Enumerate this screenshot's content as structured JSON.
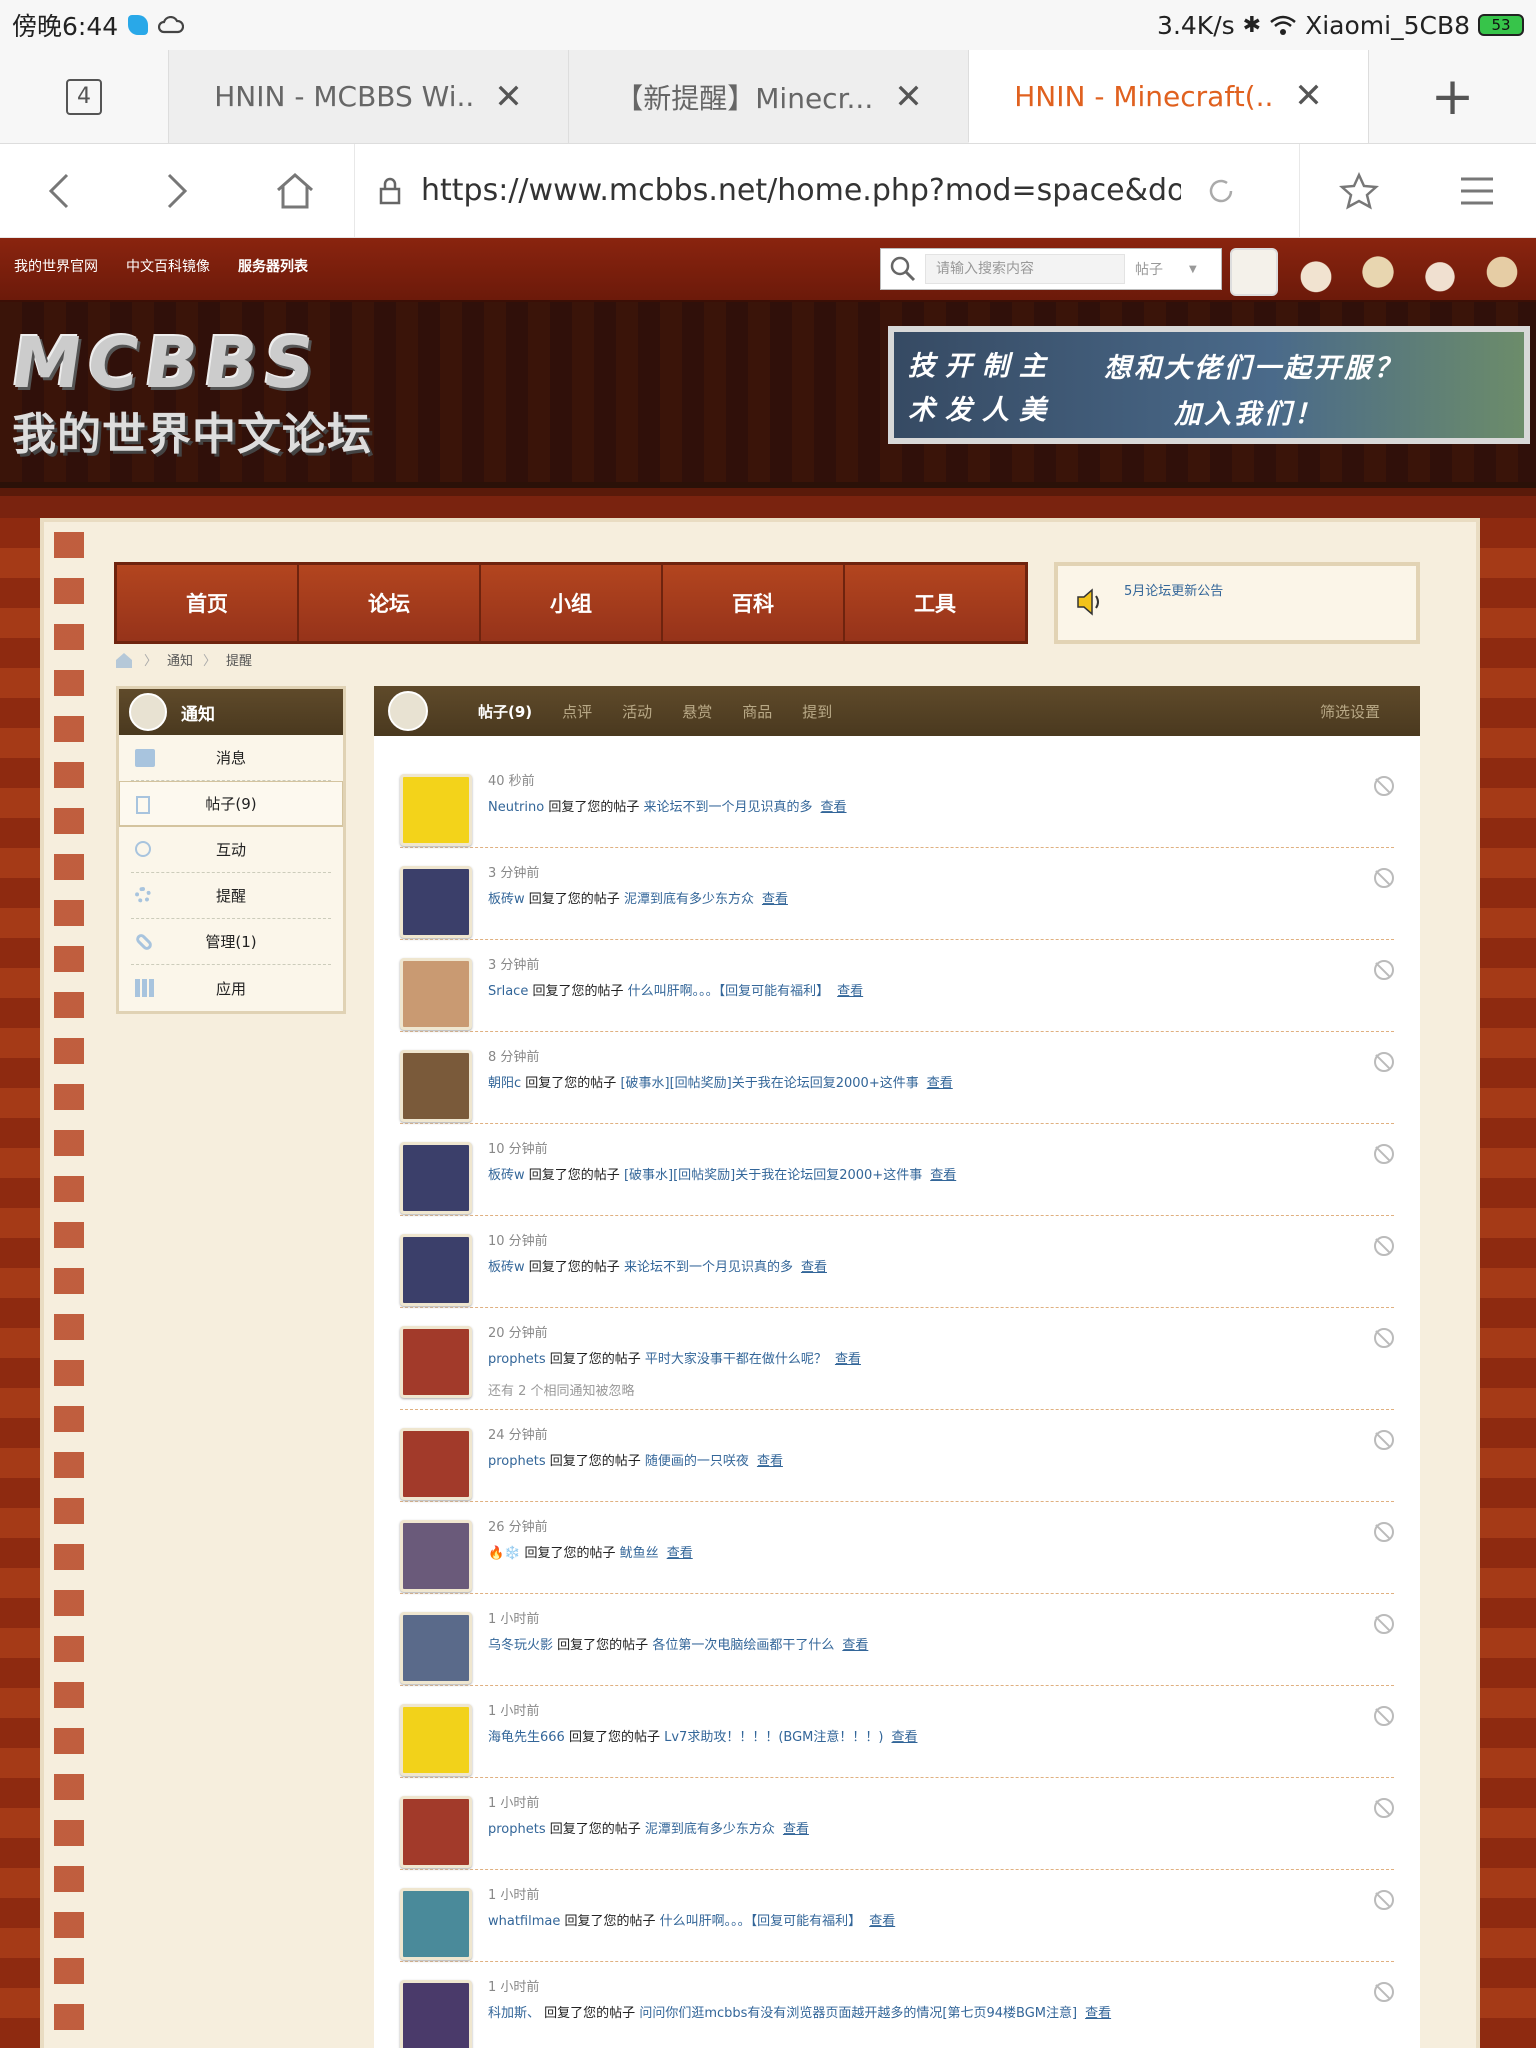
{
  "status": {
    "time": "傍晚6:44",
    "speed": "3.4K/s",
    "wifi": "Xiaomi_5CB8",
    "battery": "53"
  },
  "browser": {
    "tab_count": "4",
    "tabs": [
      {
        "label": "HNIN - MCBBS Wi..."
      },
      {
        "label": "【新提醒】Minecr..."
      },
      {
        "label": "HNIN - Minecraft(..."
      }
    ],
    "url": "https://www.mcbbs.net/home.php?mod=space&do=notice&"
  },
  "site": {
    "toplinks": [
      "我的世界官网",
      "中文百科镜像",
      "服务器列表"
    ],
    "search_placeholder": "请输入搜索内容",
    "search_scope": "帖子",
    "logo_line1": "MCBBS",
    "logo_line2": "我的世界中文论坛",
    "banner": {
      "left_top": "技开制主",
      "left_bottom": "术发人美",
      "right_top": "想和大佬们一起开服？",
      "right_bottom": "加入我们！"
    },
    "mainnav": [
      "首页",
      "论坛",
      "小组",
      "百科",
      "工具"
    ],
    "announcement": "5月论坛更新公告",
    "breadcrumb": [
      "通知",
      "提醒"
    ],
    "sidebar": {
      "title": "通知",
      "items": [
        {
          "label": "消息",
          "icon": "mail-icon"
        },
        {
          "label": "帖子(9)",
          "icon": "document-icon"
        },
        {
          "label": "互动",
          "icon": "recycle-icon"
        },
        {
          "label": "提醒",
          "icon": "gear-icon"
        },
        {
          "label": "管理(1)",
          "icon": "link-icon"
        },
        {
          "label": "应用",
          "icon": "grid-icon"
        }
      ]
    },
    "tabs": [
      "帖子(9)",
      "点评",
      "活动",
      "悬赏",
      "商品",
      "提到"
    ],
    "filter_label": "筛选设置",
    "replied_text": "回复了您的帖子",
    "view_label": "查看",
    "notices": [
      {
        "time": "40 秒前",
        "user": "Neutrino",
        "post": "来论坛不到一个月见识真的多",
        "avatar_color": "#f3d31a"
      },
      {
        "time": "3 分钟前",
        "user": "板砖w",
        "post": "泥潭到底有多少东方众",
        "avatar_color": "#3b3f6a"
      },
      {
        "time": "3 分钟前",
        "user": "Srlace",
        "post": "什么叫肝啊。。。【回复可能有福利】",
        "avatar_color": "#c99a72"
      },
      {
        "time": "8 分钟前",
        "user": "朝阳c",
        "post": "[破事水][回帖奖励]关于我在论坛回复2000+这件事",
        "avatar_color": "#7a5a3a"
      },
      {
        "time": "10 分钟前",
        "user": "板砖w",
        "post": "[破事水][回帖奖励]关于我在论坛回复2000+这件事",
        "avatar_color": "#3b3f6a"
      },
      {
        "time": "10 分钟前",
        "user": "板砖w",
        "post": "来论坛不到一个月见识真的多",
        "avatar_color": "#3b3f6a"
      },
      {
        "time": "20 分钟前",
        "user": "prophets",
        "post": "平时大家没事干都在做什么呢？",
        "avatar_color": "#a23a2a",
        "extra": "还有 2 个相同通知被忽略"
      },
      {
        "time": "24 分钟前",
        "user": "prophets",
        "post": "随便画的一只咲夜",
        "avatar_color": "#a23a2a"
      },
      {
        "time": "26 分钟前",
        "user": "🔥❄️",
        "post": "鱿鱼丝",
        "avatar_color": "#6a5a7a"
      },
      {
        "time": "1 小时前",
        "user": "乌冬玩火影",
        "post": "各位第一次电脑绘画都干了什么",
        "avatar_color": "#5a6a8a"
      },
      {
        "time": "1 小时前",
        "user": "海龟先生666",
        "post": "Lv7求助攻！！！！(BGM注意！！！)",
        "avatar_color": "#f2d21a"
      },
      {
        "time": "1 小时前",
        "user": "prophets",
        "post": "泥潭到底有多少东方众",
        "avatar_color": "#a23a2a"
      },
      {
        "time": "1 小时前",
        "user": "whatfilmae",
        "post": "什么叫肝啊。。。【回复可能有福利】",
        "avatar_color": "#4a8a9a"
      },
      {
        "time": "1 小时前",
        "user": "科加斯、",
        "post": "问问你们逛mcbbs有没有浏览器页面越开越多的情况[第七页94楼BGM注意]",
        "avatar_color": "#4a3a6a"
      }
    ]
  }
}
